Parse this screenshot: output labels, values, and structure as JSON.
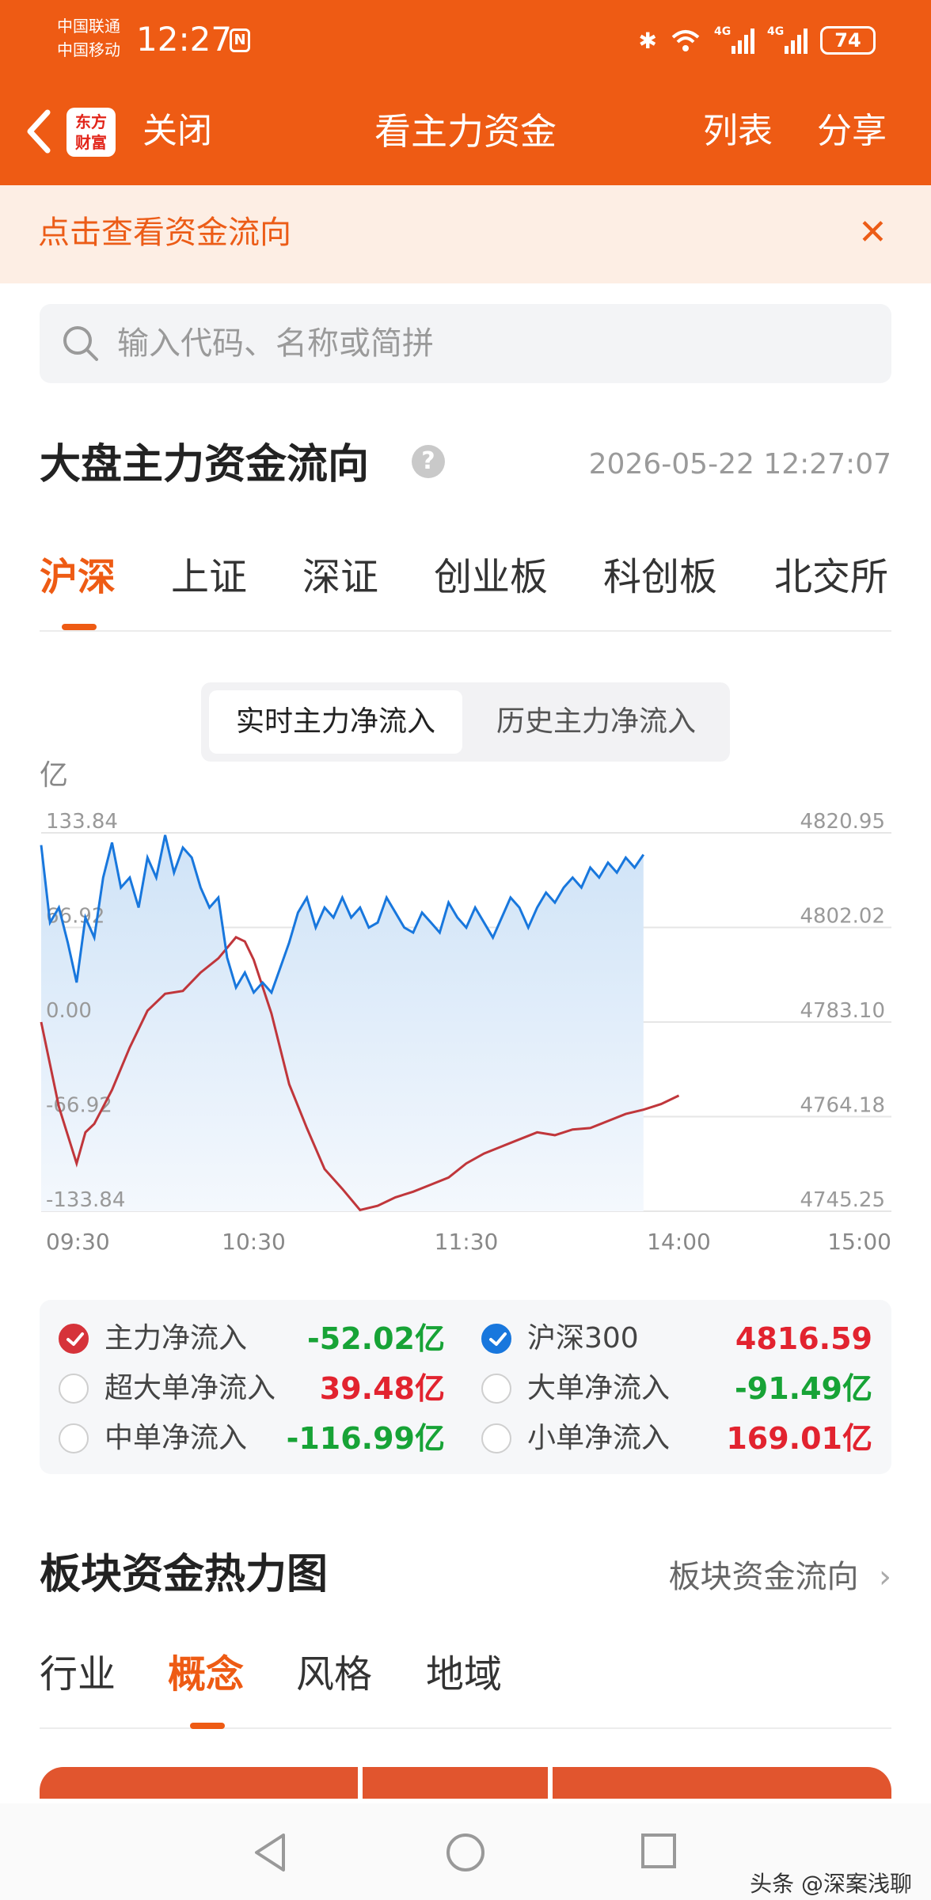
{
  "status_bar": {
    "carrier_1": "中国联通",
    "carrier_2": "中国移动",
    "time": "12:27",
    "nfc": "N",
    "net_1": "4G",
    "net_2": "4G",
    "battery": "74"
  },
  "nav": {
    "logo_line_1": "东方",
    "logo_line_2": "财富",
    "close_label": "关闭",
    "title": "看主力资金",
    "list_label": "列表",
    "share_label": "分享"
  },
  "banner": {
    "text": "点击查看资金流向",
    "close_glyph": "✕"
  },
  "search": {
    "placeholder": "输入代码、名称或简拼"
  },
  "overview": {
    "title": "大盘主力资金流向",
    "help_glyph": "?",
    "timestamp": "2026-05-22 12:27:07",
    "market_tabs": [
      "沪深",
      "上证",
      "深证",
      "创业板",
      "科创板",
      "北交所"
    ],
    "active_market_tab": "沪深",
    "mode_tabs": [
      "实时主力净流入",
      "历史主力净流入"
    ],
    "active_mode_tab": "实时主力净流入",
    "unit": "亿"
  },
  "chart_data": {
    "type": "line",
    "x_ticks": [
      "09:30",
      "10:30",
      "11:30",
      "14:00",
      "15:00"
    ],
    "left_axis": {
      "ticks": [
        "133.84",
        "66.92",
        "0.00",
        "-66.92",
        "-133.84"
      ],
      "range": [
        -133.84,
        133.84
      ]
    },
    "right_axis": {
      "ticks": [
        "4820.95",
        "4802.02",
        "4783.10",
        "4764.18",
        "4745.25"
      ],
      "range": [
        4745.25,
        4820.95
      ]
    },
    "grid": true,
    "series": [
      {
        "name": "主力净流入",
        "color": "#c0363b",
        "axis": "left",
        "points": [
          [
            0,
            0
          ],
          [
            5,
            -30
          ],
          [
            10,
            -60
          ],
          [
            15,
            -80
          ],
          [
            20,
            -100
          ],
          [
            25,
            -78
          ],
          [
            30,
            -72
          ],
          [
            40,
            -48
          ],
          [
            50,
            -18
          ],
          [
            60,
            8
          ],
          [
            70,
            20
          ],
          [
            80,
            22
          ],
          [
            90,
            35
          ],
          [
            100,
            45
          ],
          [
            110,
            60
          ],
          [
            115,
            57
          ],
          [
            120,
            44
          ],
          [
            130,
            6
          ],
          [
            140,
            -44
          ],
          [
            150,
            -75
          ],
          [
            160,
            -104
          ],
          [
            170,
            -118
          ],
          [
            180,
            -133
          ],
          [
            190,
            -130
          ],
          [
            200,
            -124
          ],
          [
            210,
            -120
          ],
          [
            220,
            -115
          ],
          [
            230,
            -110
          ],
          [
            240,
            -100
          ],
          [
            250,
            -93
          ],
          [
            260,
            -88
          ],
          [
            270,
            -83
          ],
          [
            280,
            -78
          ],
          [
            290,
            -80
          ],
          [
            300,
            -76
          ],
          [
            310,
            -75
          ],
          [
            320,
            -70
          ],
          [
            330,
            -65
          ],
          [
            340,
            -62
          ],
          [
            350,
            -58
          ],
          [
            360,
            -52
          ]
        ]
      },
      {
        "name": "沪深300",
        "color": "#1877dd",
        "axis": "right",
        "points": [
          [
            0,
            4818.5
          ],
          [
            5,
            4803
          ],
          [
            10,
            4806
          ],
          [
            15,
            4799
          ],
          [
            20,
            4791
          ],
          [
            25,
            4804
          ],
          [
            30,
            4800
          ],
          [
            35,
            4812
          ],
          [
            40,
            4819
          ],
          [
            45,
            4810
          ],
          [
            50,
            4812
          ],
          [
            55,
            4806
          ],
          [
            60,
            4816
          ],
          [
            65,
            4812
          ],
          [
            70,
            4820.5
          ],
          [
            75,
            4813
          ],
          [
            80,
            4818
          ],
          [
            85,
            4816
          ],
          [
            90,
            4810
          ],
          [
            95,
            4806
          ],
          [
            100,
            4808
          ],
          [
            105,
            4796
          ],
          [
            110,
            4790
          ],
          [
            115,
            4793
          ],
          [
            120,
            4789
          ],
          [
            125,
            4791
          ],
          [
            130,
            4789
          ],
          [
            135,
            4794
          ],
          [
            140,
            4799
          ],
          [
            145,
            4805
          ],
          [
            150,
            4808
          ],
          [
            155,
            4802
          ],
          [
            160,
            4806
          ],
          [
            165,
            4804
          ],
          [
            170,
            4808
          ],
          [
            175,
            4804
          ],
          [
            180,
            4806
          ],
          [
            185,
            4802
          ],
          [
            190,
            4803
          ],
          [
            195,
            4808
          ],
          [
            200,
            4805
          ],
          [
            205,
            4802
          ],
          [
            210,
            4801
          ],
          [
            215,
            4805
          ],
          [
            220,
            4803
          ],
          [
            225,
            4801
          ],
          [
            230,
            4807
          ],
          [
            235,
            4804
          ],
          [
            240,
            4802
          ],
          [
            245,
            4806
          ],
          [
            250,
            4803
          ],
          [
            255,
            4800
          ],
          [
            260,
            4804
          ],
          [
            265,
            4808
          ],
          [
            270,
            4806
          ],
          [
            275,
            4802
          ],
          [
            280,
            4806
          ],
          [
            285,
            4809
          ],
          [
            290,
            4807
          ],
          [
            295,
            4810
          ],
          [
            300,
            4812
          ],
          [
            305,
            4810
          ],
          [
            310,
            4814
          ],
          [
            315,
            4812
          ],
          [
            320,
            4815
          ],
          [
            325,
            4813
          ],
          [
            330,
            4816
          ],
          [
            335,
            4814
          ],
          [
            340,
            4816.59
          ]
        ]
      }
    ]
  },
  "legend": [
    {
      "name": "主力净流入",
      "value": "-52.02亿",
      "sign": "neg",
      "checked": "red"
    },
    {
      "name": "沪深300",
      "value": "4816.59",
      "sign": "pos",
      "checked": "blue"
    },
    {
      "name": "超大单净流入",
      "value": "39.48亿",
      "sign": "pos",
      "checked": ""
    },
    {
      "name": "大单净流入",
      "value": "-91.49亿",
      "sign": "neg",
      "checked": ""
    },
    {
      "name": "中单净流入",
      "value": "-116.99亿",
      "sign": "neg",
      "checked": ""
    },
    {
      "name": "小单净流入",
      "value": "169.01亿",
      "sign": "pos",
      "checked": ""
    }
  ],
  "heatmap": {
    "title": "板块资金热力图",
    "more_label": "板块资金流向",
    "tabs": [
      "行业",
      "概念",
      "风格",
      "地域"
    ],
    "active_tab": "概念"
  },
  "watermark": "头条 @深案浅聊",
  "colors": {
    "brand": "#ee5b14",
    "up": "#e2232f",
    "down": "#17a336",
    "index_line": "#1877dd"
  }
}
